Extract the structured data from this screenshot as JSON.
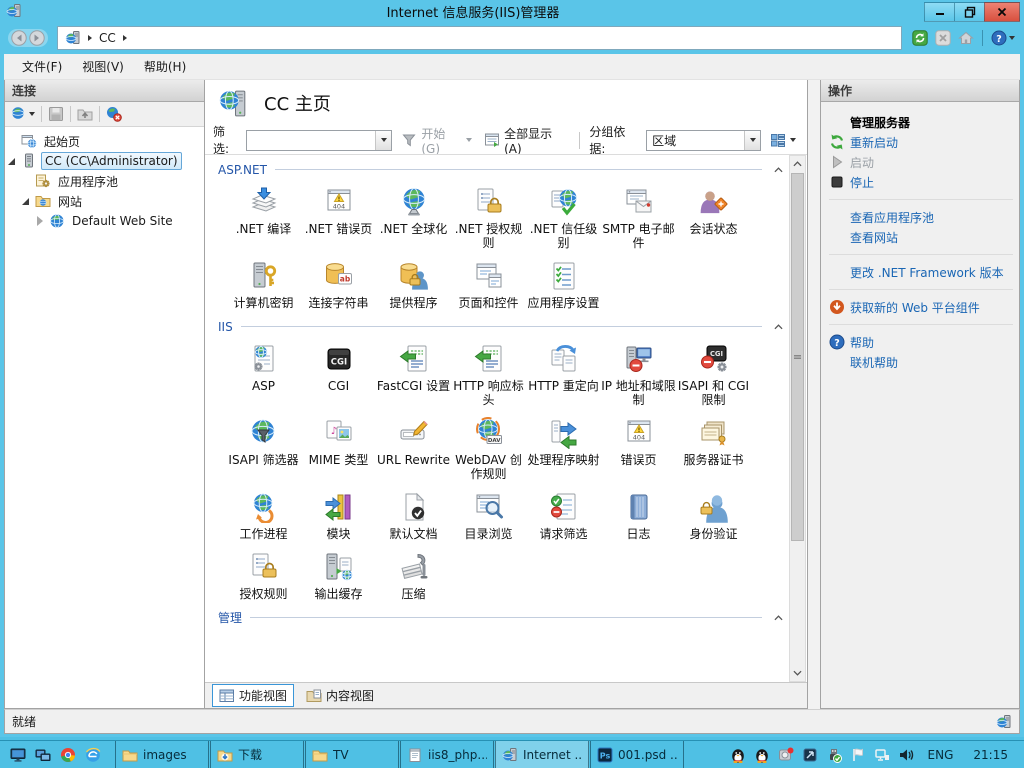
{
  "window": {
    "title": "Internet 信息服务(IIS)管理器"
  },
  "address": {
    "breadcrumb": "CC",
    "icons": [
      "refresh",
      "stop-x",
      "home",
      "help"
    ]
  },
  "menu": {
    "items": [
      "文件(F)",
      "视图(V)",
      "帮助(H)"
    ]
  },
  "connections": {
    "title": "连接",
    "toolbar_icons": [
      "conn-globe",
      "save",
      "folder-up",
      "disconnect"
    ],
    "tree": [
      {
        "label": "起始页",
        "icon": "start-page",
        "level": 1,
        "expander": "none",
        "selected": false
      },
      {
        "label": "CC (CC\\Administrator)",
        "icon": "server",
        "level": 1,
        "expander": "expanded",
        "selected": true
      },
      {
        "label": "应用程序池",
        "icon": "app-pools",
        "level": 2,
        "expander": "none",
        "selected": false
      },
      {
        "label": "网站",
        "icon": "sites",
        "level": 2,
        "expander": "expanded",
        "selected": false
      },
      {
        "label": "Default Web Site",
        "icon": "site",
        "level": 3,
        "expander": "collapsed",
        "selected": false
      }
    ]
  },
  "page": {
    "title": "CC 主页",
    "filter_label": "筛选:",
    "go_label": "开始(G)",
    "show_all_label": "全部显示(A)",
    "group_by_label": "分组依据:",
    "group_value": "区域",
    "sections": [
      {
        "name": "ASP.NET",
        "items": [
          {
            "label": ".NET 编译",
            "icon": "net-compile"
          },
          {
            "label": ".NET 错误页",
            "icon": "error-404"
          },
          {
            "label": ".NET 全球化",
            "icon": "globe-stand"
          },
          {
            "label": ".NET 授权规则",
            "icon": "doc-lock"
          },
          {
            "label": ".NET 信任级别",
            "icon": "globe-check"
          },
          {
            "label": "SMTP 电子邮件",
            "icon": "smtp-mail"
          },
          {
            "label": "会话状态",
            "icon": "person-state"
          },
          {
            "label": "计算机密钥",
            "icon": "machine-key"
          },
          {
            "label": "连接字符串",
            "icon": "db-string"
          },
          {
            "label": "提供程序",
            "icon": "db-provider"
          },
          {
            "label": "页面和控件",
            "icon": "pages-controls"
          },
          {
            "label": "应用程序设置",
            "icon": "app-settings"
          }
        ]
      },
      {
        "name": "IIS",
        "items": [
          {
            "label": "ASP",
            "icon": "asp"
          },
          {
            "label": "CGI",
            "icon": "cgi"
          },
          {
            "label": "FastCGI 设置",
            "icon": "doc-arrow"
          },
          {
            "label": "HTTP 响应标头",
            "icon": "doc-arrow"
          },
          {
            "label": "HTTP 重定向",
            "icon": "redirect"
          },
          {
            "label": "IP 地址和域限制",
            "icon": "ip-restrict"
          },
          {
            "label": "ISAPI 和 CGI 限制",
            "icon": "cgi-restrict"
          },
          {
            "label": "ISAPI 筛选器",
            "icon": "globe-funnel"
          },
          {
            "label": "MIME 类型",
            "icon": "mime"
          },
          {
            "label": "URL Rewrite",
            "icon": "url-rewrite"
          },
          {
            "label": "WebDAV 创作规则",
            "icon": "webdav"
          },
          {
            "label": "处理程序映射",
            "icon": "handler-map"
          },
          {
            "label": "错误页",
            "icon": "error-404"
          },
          {
            "label": "服务器证书",
            "icon": "certificates"
          },
          {
            "label": "工作进程",
            "icon": "worker-process"
          },
          {
            "label": "模块",
            "icon": "modules"
          },
          {
            "label": "默认文档",
            "icon": "default-doc"
          },
          {
            "label": "目录浏览",
            "icon": "dir-browse"
          },
          {
            "label": "请求筛选",
            "icon": "request-filter"
          },
          {
            "label": "日志",
            "icon": "logging"
          },
          {
            "label": "身份验证",
            "icon": "authentication"
          },
          {
            "label": "授权规则",
            "icon": "doc-lock"
          },
          {
            "label": "输出缓存",
            "icon": "output-cache"
          },
          {
            "label": "压缩",
            "icon": "compression"
          }
        ]
      },
      {
        "name": "管理",
        "items": []
      }
    ],
    "tabs": [
      {
        "label": "功能视图",
        "icon": "features-view",
        "selected": true
      },
      {
        "label": "内容视图",
        "icon": "content-view",
        "selected": false
      }
    ]
  },
  "actions": {
    "title": "操作",
    "groups": [
      [
        {
          "label": "管理服务器",
          "style": "header"
        },
        {
          "label": "重新启动",
          "icon": "restart",
          "style": "link"
        },
        {
          "label": "启动",
          "icon": "play",
          "style": "disabled"
        },
        {
          "label": "停止",
          "icon": "stop",
          "style": "link"
        }
      ],
      [
        {
          "label": "查看应用程序池",
          "style": "link"
        },
        {
          "label": "查看网站",
          "style": "link"
        }
      ],
      [
        {
          "label": "更改 .NET Framework 版本",
          "style": "link"
        }
      ],
      [
        {
          "label": "获取新的 Web 平台组件",
          "icon": "webpi",
          "style": "link"
        }
      ],
      [
        {
          "label": "帮助",
          "icon": "help",
          "style": "link"
        },
        {
          "label": "联机帮助",
          "style": "link"
        }
      ]
    ]
  },
  "status": {
    "text": "就绪"
  },
  "taskbar": {
    "start_icons": [
      "monitor",
      "pc-network",
      "chrome",
      "ie"
    ],
    "buttons": [
      {
        "label": "images",
        "icon": "folder",
        "active": false
      },
      {
        "label": "下载",
        "icon": "folder-download",
        "active": false
      },
      {
        "label": "TV",
        "icon": "folder",
        "active": false
      },
      {
        "label": "iis8_php...",
        "icon": "notepad",
        "active": false
      },
      {
        "label": "Internet ...",
        "icon": "iis",
        "active": true
      },
      {
        "label": "001.psd ...",
        "icon": "photoshop",
        "active": false
      }
    ],
    "tray_icons": [
      "qq",
      "qq",
      "capture",
      "viewer",
      "usb",
      "flag",
      "network",
      "volume"
    ],
    "lang": "ENG",
    "time": "21:15"
  }
}
